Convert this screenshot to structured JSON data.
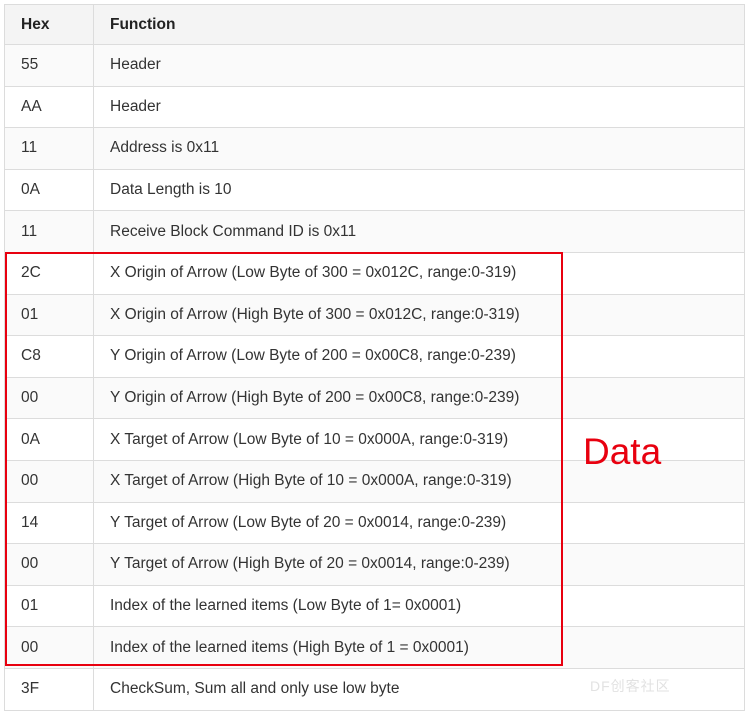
{
  "table": {
    "headers": [
      "Hex",
      "Function"
    ],
    "rows": [
      [
        "55",
        "Header"
      ],
      [
        "AA",
        "Header"
      ],
      [
        "11",
        "Address is 0x11"
      ],
      [
        "0A",
        "Data Length is 10"
      ],
      [
        "11",
        "Receive Block Command ID is 0x11"
      ],
      [
        "2C",
        "X Origin of Arrow (Low Byte of 300 = 0x012C, range:0-319)"
      ],
      [
        "01",
        "X Origin of Arrow (High Byte of 300 = 0x012C, range:0-319)"
      ],
      [
        "C8",
        "Y Origin of Arrow (Low Byte of 200 = 0x00C8, range:0-239)"
      ],
      [
        "00",
        "Y Origin of Arrow (High Byte of 200 = 0x00C8, range:0-239)"
      ],
      [
        "0A",
        "X Target of Arrow (Low Byte of 10 = 0x000A, range:0-319)"
      ],
      [
        "00",
        "X Target of Arrow (High Byte of 10 = 0x000A, range:0-319)"
      ],
      [
        "14",
        "Y Target of Arrow (Low Byte of 20 = 0x0014, range:0-239)"
      ],
      [
        "00",
        "Y Target of Arrow (High Byte of 20 = 0x0014, range:0-239)"
      ],
      [
        "01",
        "Index of the learned items (Low Byte of 1= 0x0001)"
      ],
      [
        "00",
        "Index of the learned items (High Byte of 1 = 0x0001)"
      ],
      [
        "3F",
        "CheckSum, Sum all and only use low byte"
      ]
    ]
  },
  "highlight": {
    "label": "Data",
    "color": "#e8000f"
  },
  "watermark": {
    "text": "DF创客社区"
  }
}
